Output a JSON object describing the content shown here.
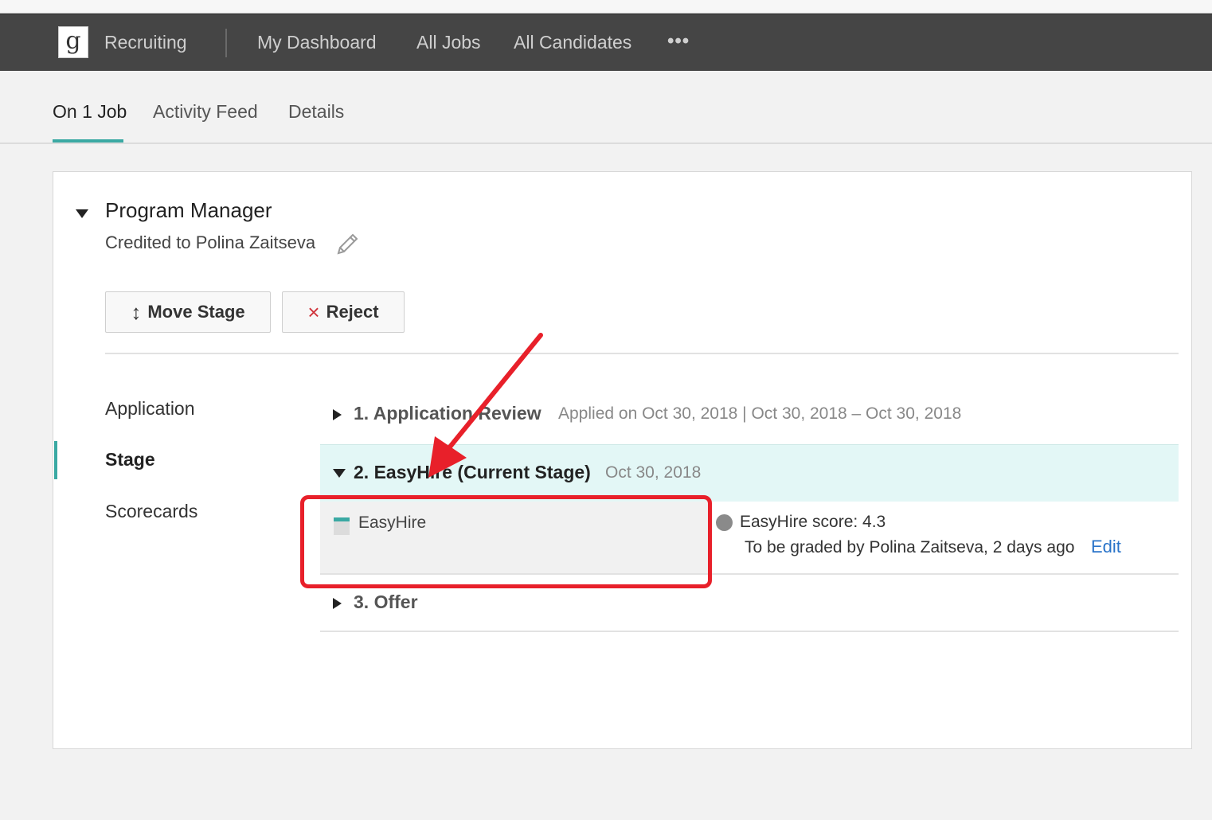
{
  "nav": {
    "logo_letter": "g",
    "app_name": "Recruiting",
    "links": [
      "My Dashboard",
      "All Jobs",
      "All Candidates"
    ],
    "more": "•••"
  },
  "tabs": [
    "On 1 Job",
    "Activity Feed",
    "Details"
  ],
  "job": {
    "title": "Program Manager",
    "credited": "Credited to Polina Zaitseva",
    "move_stage_label": "Move Stage",
    "reject_label": "Reject",
    "reject_icon": "×",
    "move_icon": "↕"
  },
  "sidebar": [
    "Application",
    "Stage",
    "Scorecards"
  ],
  "stages": [
    {
      "label": "1.  Application Review",
      "meta": "Applied on Oct 30, 2018 | Oct 30, 2018 – Oct 30, 2018"
    },
    {
      "label": "2.  EasyHire (Current Stage)",
      "meta": "Oct 30, 2018"
    },
    {
      "label": "3.  Offer",
      "meta": ""
    }
  ],
  "integration": {
    "name": "EasyHire",
    "score": "EasyHire score: 4.3",
    "graded": "To be graded by Polina Zaitseva, 2 days ago",
    "edit": "Edit"
  },
  "colors": {
    "accent": "#3aa9a3",
    "navbar": "#454545",
    "current_stage_bg": "#e3f7f6",
    "annotation_red": "#e8202a",
    "link": "#2a74c9"
  }
}
